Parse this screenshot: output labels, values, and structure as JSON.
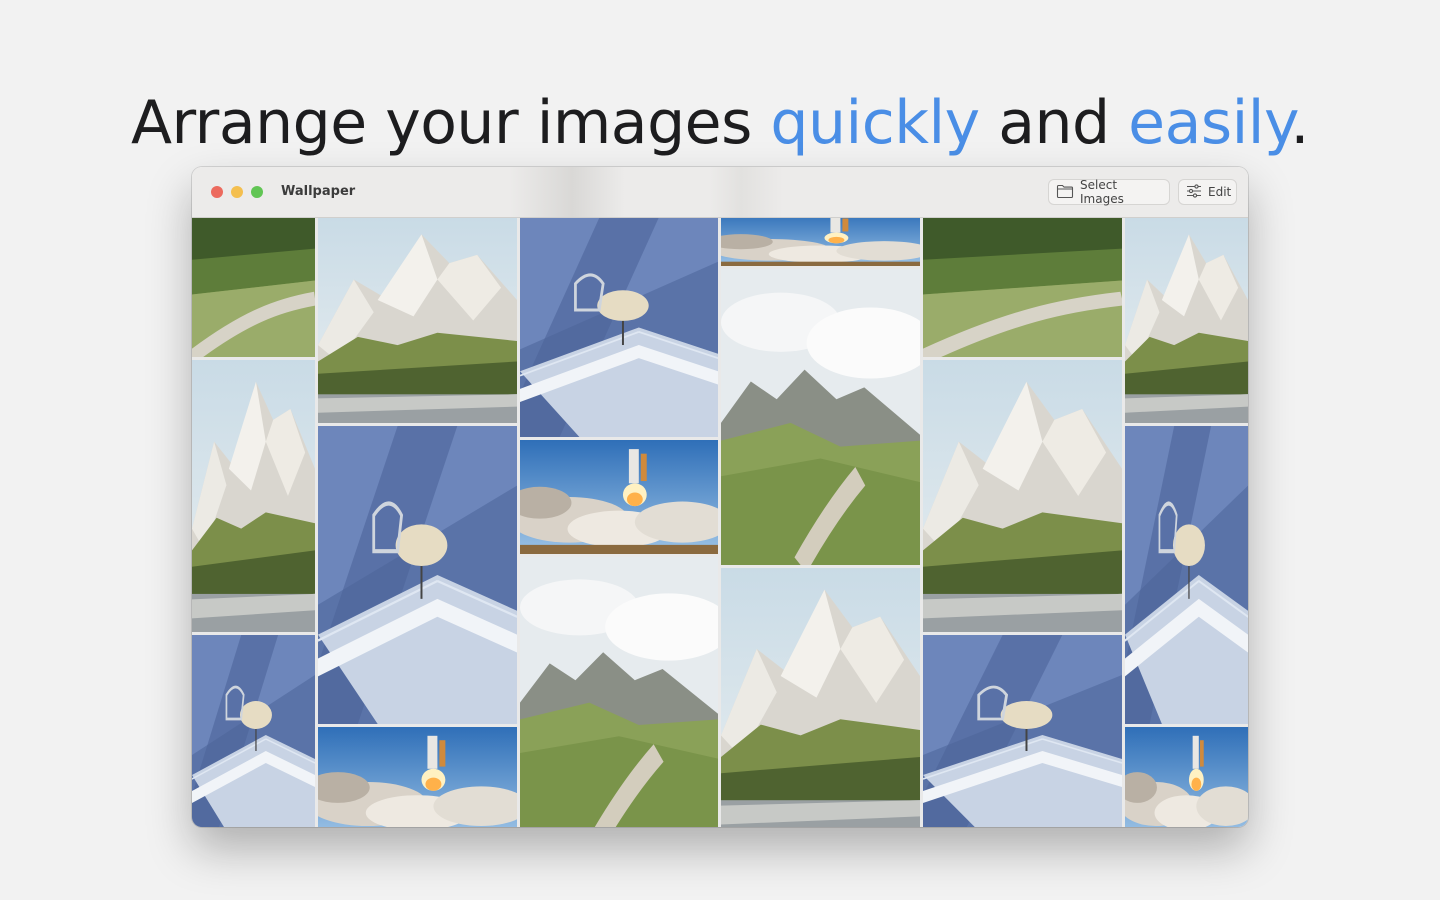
{
  "headline": {
    "part1": "Arrange your images ",
    "accent1": "quickly",
    "part2": " and ",
    "accent2": "easily",
    "part3": "."
  },
  "window": {
    "title": "Wallpaper",
    "toolbar": {
      "select_images_label": "Select Images",
      "select_images_icon": "folder-icon",
      "edit_label": "Edit",
      "edit_icon": "sliders-icon"
    }
  },
  "grid": {
    "columns": [
      {
        "tiles": [
          "hills-path",
          "snowy-peak",
          "balcony-chair"
        ]
      },
      {
        "tiles": [
          "snowy-peak",
          "balcony-chair",
          "shuttle-launch"
        ]
      },
      {
        "tiles": [
          "balcony-chair",
          "shuttle-launch",
          "valley-clouds"
        ]
      },
      {
        "tiles": [
          "shuttle-launch",
          "valley-clouds",
          "snowy-peak"
        ]
      },
      {
        "tiles": [
          "hills-path",
          "snowy-peak",
          "balcony-chair"
        ]
      },
      {
        "tiles": [
          "snowy-peak",
          "balcony-chair",
          "shuttle-launch"
        ]
      }
    ]
  },
  "colors": {
    "accent": "#4a8ee6",
    "close": "#ec6a5e",
    "minimize": "#f4bf4f",
    "maximize": "#61c554"
  }
}
